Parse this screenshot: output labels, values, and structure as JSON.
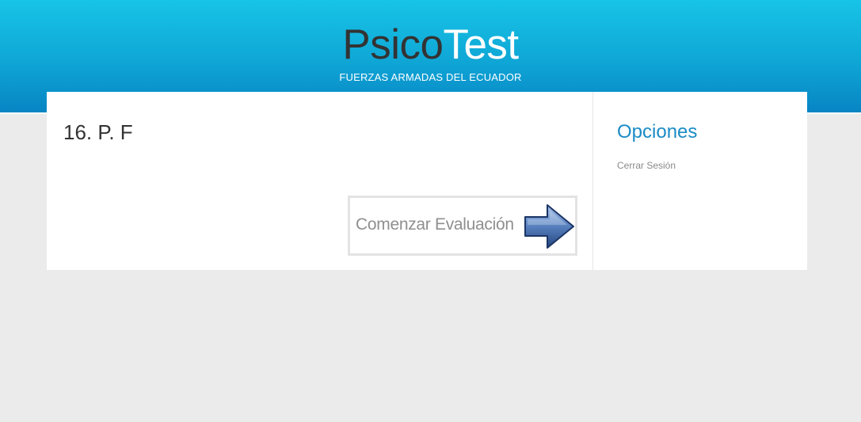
{
  "header": {
    "logo_part1": "Psico",
    "logo_part2": "Test",
    "tagline": "FUERZAS ARMADAS DEL ECUADOR"
  },
  "main": {
    "title": "16. P. F",
    "start_button": {
      "label": "Comenzar Evaluación",
      "icon": "arrow-right-icon"
    }
  },
  "sidebar": {
    "title": "Opciones",
    "links": [
      {
        "label": "Cerrar Sesión"
      }
    ]
  },
  "colors": {
    "header_gradient_top": "#17c4e6",
    "header_gradient_bottom": "#0785c3",
    "accent": "#1a8bc6",
    "page_background": "#ebebeb"
  }
}
